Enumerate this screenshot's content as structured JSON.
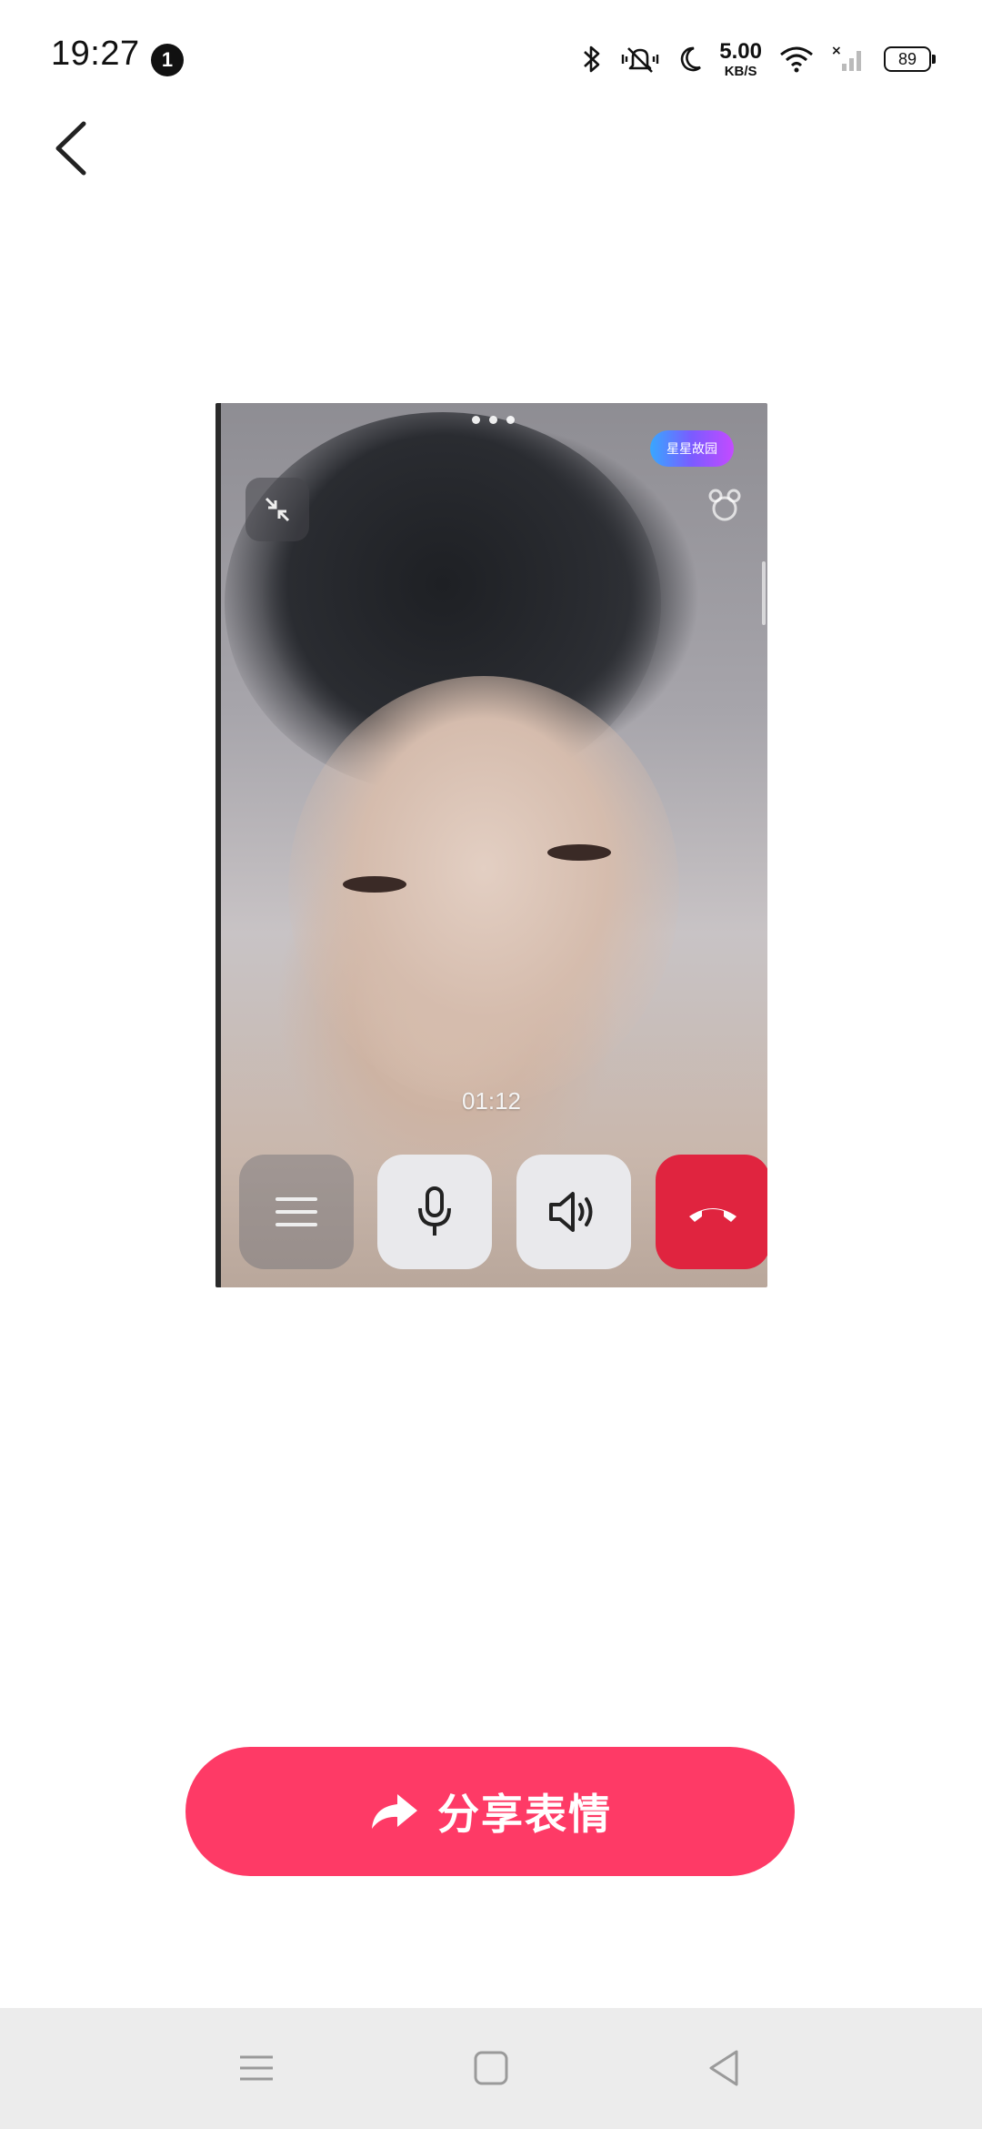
{
  "status_bar": {
    "time": "19:27",
    "notification_count": "1",
    "net_speed_value": "5.00",
    "net_speed_unit": "KB/S",
    "battery_level": "89"
  },
  "video": {
    "call_timer": "01:12",
    "feature_pill_label": "星星故园"
  },
  "share_button": {
    "label": "分享表情"
  },
  "colors": {
    "accent": "#fe3a66",
    "hangup": "#e0243f",
    "nav_bg": "#ececec"
  }
}
